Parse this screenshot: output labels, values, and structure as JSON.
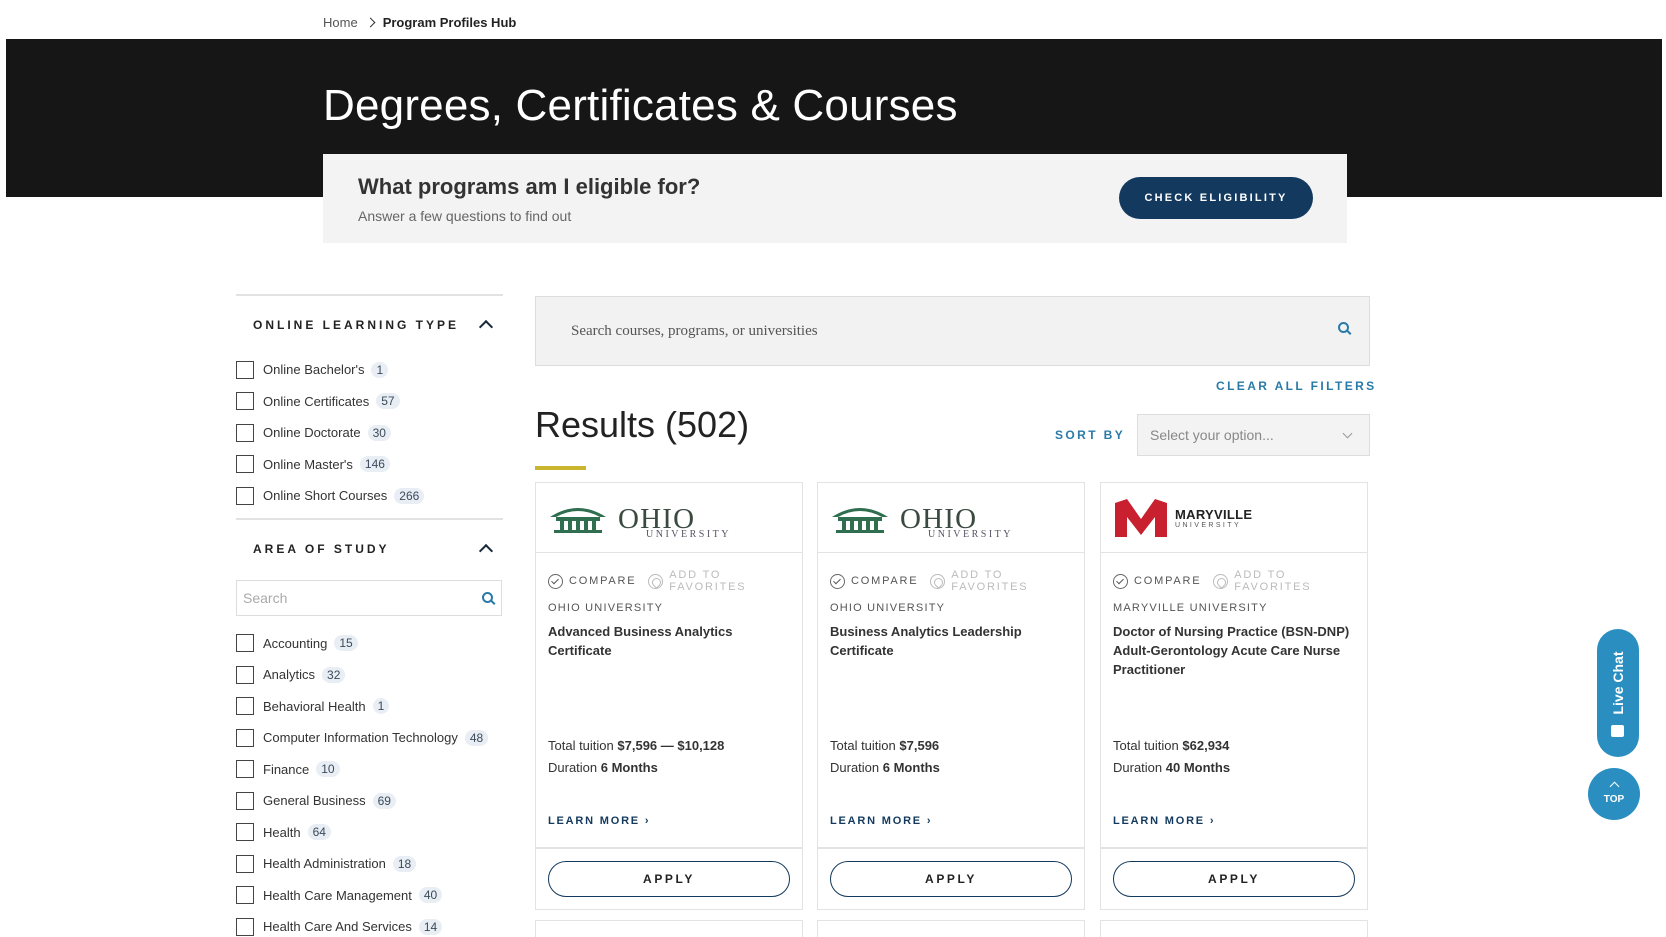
{
  "breadcrumb": {
    "home": "Home",
    "current": "Program Profiles Hub"
  },
  "hero": {
    "title": "Degrees, Certificates & Courses"
  },
  "eligibility": {
    "question": "What programs am I eligible for?",
    "subtitle": "Answer a few questions to find out",
    "button": "CHECK ELIGIBILITY"
  },
  "filters": {
    "learning_type": {
      "title": "ONLINE LEARNING TYPE",
      "items": [
        {
          "label": "Online Bachelor's",
          "count": "1"
        },
        {
          "label": "Online Certificates",
          "count": "57"
        },
        {
          "label": "Online Doctorate",
          "count": "30"
        },
        {
          "label": "Online Master's",
          "count": "146"
        },
        {
          "label": "Online Short Courses",
          "count": "266"
        }
      ]
    },
    "area_of_study": {
      "title": "AREA OF STUDY",
      "search_placeholder": "Search",
      "items": [
        {
          "label": "Accounting",
          "count": "15"
        },
        {
          "label": "Analytics",
          "count": "32"
        },
        {
          "label": "Behavioral Health",
          "count": "1"
        },
        {
          "label": "Computer Information Technology",
          "count": "48"
        },
        {
          "label": "Finance",
          "count": "10"
        },
        {
          "label": "General Business",
          "count": "69"
        },
        {
          "label": "Health",
          "count": "64"
        },
        {
          "label": "Health Administration",
          "count": "18"
        },
        {
          "label": "Health Care Management",
          "count": "40"
        },
        {
          "label": "Health Care And Services",
          "count": "14"
        }
      ]
    }
  },
  "search": {
    "placeholder": "Search courses, programs, or universities"
  },
  "clear_filters": "CLEAR ALL FILTERS",
  "results": {
    "title": "Results (502)"
  },
  "sort": {
    "label": "SORT BY",
    "placeholder": "Select your option..."
  },
  "cards": [
    {
      "logo": {
        "name": "OHIO",
        "sub": "UNIVERSITY",
        "icon": "ohio-university-logo-icon"
      },
      "compare": "COMPARE",
      "favorite": "ADD TO FAVORITES",
      "university": "OHIO UNIVERSITY",
      "program": "Advanced Business Analytics Certificate",
      "tuition_label": "Total tuition",
      "tuition": "$7,596 — $10,128",
      "duration_label": "Duration",
      "duration": "6 Months",
      "learn_more": "LEARN MORE",
      "apply": "APPLY"
    },
    {
      "logo": {
        "name": "OHIO",
        "sub": "UNIVERSITY",
        "icon": "ohio-university-logo-icon"
      },
      "compare": "COMPARE",
      "favorite": "ADD TO FAVORITES",
      "university": "OHIO UNIVERSITY",
      "program": "Business Analytics Leadership Certificate",
      "tuition_label": "Total tuition",
      "tuition": "$7,596",
      "duration_label": "Duration",
      "duration": "6 Months",
      "learn_more": "LEARN MORE",
      "apply": "APPLY"
    },
    {
      "logo": {
        "name": "MARYVILLE",
        "sub": "UNIVERSITY",
        "icon": "maryville-university-logo-icon"
      },
      "compare": "COMPARE",
      "favorite": "ADD TO FAVORITES",
      "university": "MARYVILLE UNIVERSITY",
      "program": "Doctor of Nursing Practice (BSN-DNP) Adult-Gerontology Acute Care Nurse Practitioner",
      "tuition_label": "Total tuition",
      "tuition": "$62,934",
      "duration_label": "Duration",
      "duration": "40 Months",
      "learn_more": "LEARN MORE",
      "apply": "APPLY"
    }
  ],
  "floating": {
    "live_chat": "Live Chat",
    "top": "TOP"
  },
  "colors": {
    "navy": "#133a5e",
    "link_blue": "#2a7aa8",
    "chat_blue": "#2a8fc0",
    "accent_gold": "#c9b62e",
    "hero_bg": "#161616",
    "ohio_green": "#2f6e4f",
    "maryville_red": "#c8202f"
  }
}
